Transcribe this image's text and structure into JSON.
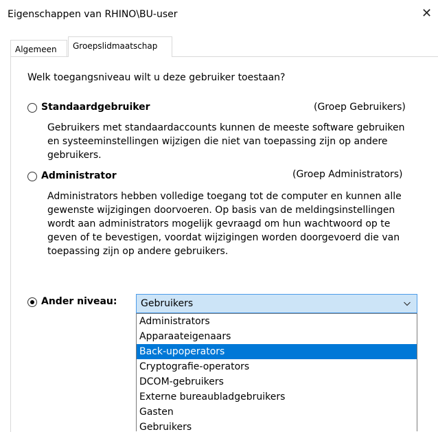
{
  "window": {
    "title": "Eigenschappen van RHINO\\BU-user",
    "close_glyph": "✕"
  },
  "tabs": [
    {
      "label": "Algemeen",
      "active": false
    },
    {
      "label": "Groepslidmaatschap",
      "active": true
    }
  ],
  "question": "Welk toegangsniveau wilt u deze gebruiker toestaan?",
  "options": {
    "standard": {
      "label": "Standaardgebruiker",
      "group": "(Groep Gebruikers)",
      "desc1": "Gebruikers met standaardaccounts kunnen de meeste software gebruiken",
      "desc2": "en systeeminstellingen wijzigen die niet van toepassing zijn op andere",
      "desc3": "gebruikers.",
      "checked": false
    },
    "admin": {
      "label": "Administrator",
      "group": "(Groep Administrators)",
      "desc1": "Administrators hebben volledige toegang tot de computer en kunnen alle",
      "desc2": "gewenste wijzigingen doorvoeren. Op basis van de meldingsinstellingen",
      "desc3": "wordt aan administrators mogelijk gevraagd om hun wachtwoord op te",
      "desc4": "geven of te bevestigen, voordat wijzigingen worden doorgevoerd die van",
      "desc5": "toepassing zijn op andere gebruikers.",
      "checked": false
    },
    "other": {
      "label": "Ander niveau:",
      "checked": true
    }
  },
  "dropdown": {
    "selected": "Gebruikers",
    "highlighted": "Back-upoperators",
    "items": [
      "Administrators",
      "Apparaateigenaars",
      "Back-upoperators",
      "Cryptografie-operators",
      "DCOM-gebruikers",
      "Externe bureaubladgebruikers",
      "Gasten",
      "Gebruikers"
    ]
  },
  "colors": {
    "highlight": "#0078d7",
    "select_bg": "#cce4f7",
    "select_border": "#4c9be8"
  }
}
